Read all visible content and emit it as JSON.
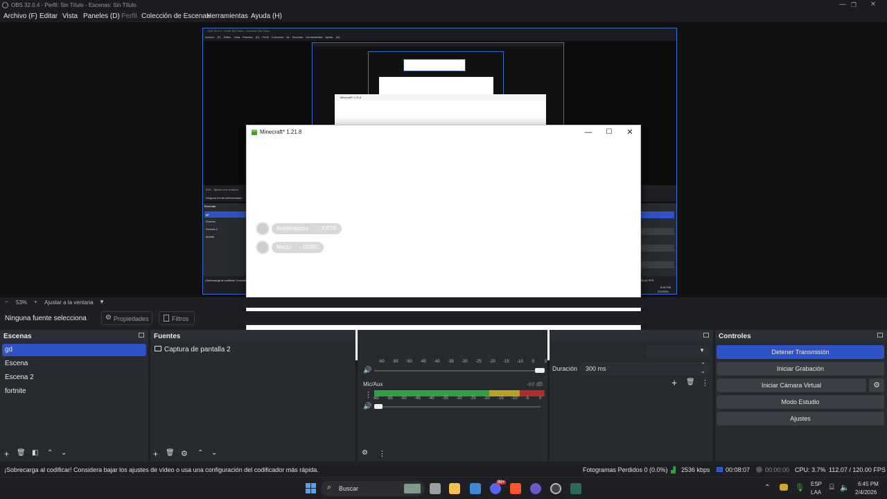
{
  "titlebar": {
    "title": "OBS 32.0.4 - Perfil: Sin Título - Escenas: Sin Título"
  },
  "menubar": {
    "items": [
      "Archivo (F)",
      "Editar",
      "Vista",
      "Paneles (D)",
      "Perfil",
      "Colección de Escenas",
      "Herramientas",
      "Ayuda (H)"
    ]
  },
  "nested": {
    "title": "OBS 32.0.4 - Perfil: Sin Título - Escenas: Sin Título",
    "menu": "Archivo (F)  Editar  Vista  Paneles (D)  Perfil  Colección de Escenas  Herramientas  Ayuda (H)",
    "inner_title": "Minecraft* 1.21.8",
    "zoom": "53%",
    "fit": "Ajustar a la ventana",
    "source": "Ninguna fuente seleccionada",
    "scenes_header": "Escenas",
    "scenes": [
      "gd",
      "Escena",
      "Escena 2",
      "fortnite"
    ],
    "status": "¡Sobrecarga al codificar! Considera...",
    "fps": "112.07 / 120.00 FPS",
    "time": "6:45 PM",
    "date": "2/4/2026"
  },
  "minecraft": {
    "title": "Minecraft* 1.21.8",
    "chat": [
      {
        "name": "itsdiekopizza",
        "tag": "ASTR"
      },
      {
        "name": "Marzz",
        "tag": "DDBC"
      }
    ]
  },
  "zoombar": {
    "minus": "−",
    "zoom": "53%",
    "plus": "+",
    "fit": "Ajustar a la ventana"
  },
  "sourcebar": {
    "none": "Ninguna fuente selecciona",
    "properties": "Propiedades",
    "filters": "Filtros"
  },
  "scenes": {
    "header": "Escenas",
    "items": [
      "gd",
      "Escena",
      "Escena 2",
      "fortnite"
    ]
  },
  "sources": {
    "header": "Fuentes",
    "items": [
      "Captura de pantalla 2"
    ]
  },
  "mixer": {
    "ticks": [
      "-60",
      "-55",
      "-50",
      "-45",
      "-40",
      "-35",
      "-30",
      "-25",
      "-20",
      "-15",
      "-10",
      "-5",
      "0"
    ],
    "channel": "Mic/Aux",
    "level": "-inf dB"
  },
  "transitions": {
    "duration_label": "Duración",
    "duration_value": "300 ms"
  },
  "controls": {
    "header": "Controles",
    "buttons": [
      "Detener Transmisión",
      "Iniciar Grabación",
      "Iniciar Cámara Virtual",
      "Modo Estudio",
      "Ajustes"
    ]
  },
  "status": {
    "warning": "¡Sobrecarga al codificar! Considera bajar los ajustes de vídeo o usa una configuración del codificador más rápida.",
    "dropped": "Fotogramas Perdidos 0 (0.0%)",
    "bitrate": "2536 kbps",
    "stream_time": "00:08:07",
    "rec_time": "00:00:00",
    "cpu": "CPU: 3.7%",
    "fps": "112.07 / 120.00 FPS"
  },
  "taskbar": {
    "search": "Buscar",
    "lang": "ESP",
    "layout": "LAA",
    "time": "6:45 PM",
    "date": "2/4/2026",
    "badge": "99+"
  },
  "colors": {
    "accent": "#2f53c7",
    "border": "#3b6dd6",
    "green": "#2fa044",
    "yellow": "#b8a023",
    "red": "#b42a2a"
  }
}
